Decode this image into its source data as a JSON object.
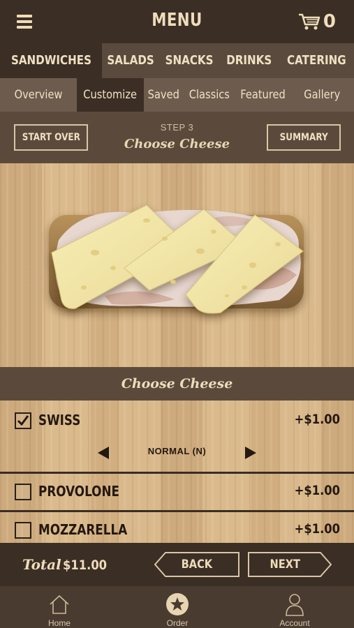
{
  "header": {
    "title": "MENU",
    "cart_count": "0"
  },
  "icons": {
    "menu": "hamburger-icon",
    "cart": "cart-icon",
    "check": "check-icon",
    "home": "home-icon",
    "order": "star-icon",
    "account": "account-icon"
  },
  "categories": [
    {
      "label": "SANDWICHES",
      "active": true
    },
    {
      "label": "SALADS",
      "active": false
    },
    {
      "label": "SNACKS",
      "active": false
    },
    {
      "label": "DRINKS",
      "active": false
    },
    {
      "label": "CATERING",
      "active": false
    }
  ],
  "subtabs": [
    {
      "label": "Overview",
      "active": false
    },
    {
      "label": "Customize",
      "active": true
    },
    {
      "label": "Saved",
      "active": false
    },
    {
      "label": "Classics",
      "active": false
    },
    {
      "label": "Featured",
      "active": false
    },
    {
      "label": "Gallery",
      "active": false
    }
  ],
  "step": {
    "start_over": "START OVER",
    "label": "STEP 3",
    "title": "Choose Cheese",
    "summary": "SUMMARY"
  },
  "section": {
    "title": "Choose Cheese"
  },
  "options": [
    {
      "name": "SWISS",
      "price": "+$1.00",
      "checked": true,
      "portion": "NORMAL (N)"
    },
    {
      "name": "PROVOLONE",
      "price": "+$1.00",
      "checked": false
    },
    {
      "name": "MOZZARELLA",
      "price": "+$1.00",
      "checked": false
    }
  ],
  "footer": {
    "total_label": "Total",
    "total_value": "$11.00",
    "back": "BACK",
    "next": "NEXT"
  },
  "tabbar": [
    {
      "label": "Home"
    },
    {
      "label": "Order"
    },
    {
      "label": "Account"
    }
  ],
  "colors": {
    "dark_brown": "#3b2e25",
    "mid_brown": "#5b4a3c",
    "cream_text": "#eedcbb",
    "cheese": "#f2e6a4"
  }
}
